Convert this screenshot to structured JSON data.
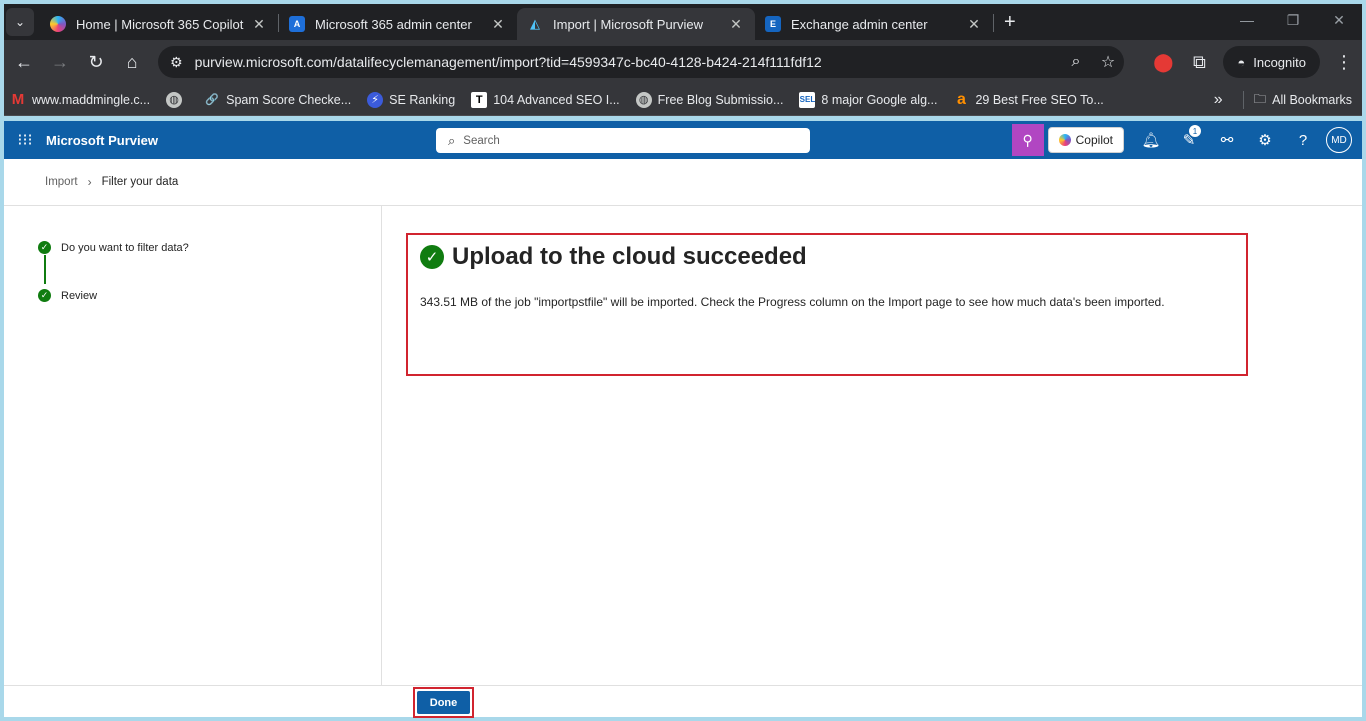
{
  "browser": {
    "tabs": [
      {
        "title": "Home | Microsoft 365 Copilot",
        "icon": "copilot-icon",
        "active": false
      },
      {
        "title": "Microsoft 365 admin center",
        "icon": "admin-center-icon",
        "active": false
      },
      {
        "title": "Import | Microsoft Purview",
        "icon": "purview-icon",
        "active": true
      },
      {
        "title": "Exchange admin center",
        "icon": "exchange-icon",
        "active": false
      }
    ],
    "url": "purview.microsoft.com/datalifecyclemanagement/import?tid=4599347c-bc40-4128-b424-214f111fdf12",
    "incognito_label": "Incognito",
    "bookmarks": [
      {
        "label": "www.maddmingle.c...",
        "icon": "M"
      },
      {
        "label": "",
        "icon": "globe"
      },
      {
        "label": "Spam Score Checke...",
        "icon": "link"
      },
      {
        "label": "SE Ranking",
        "icon": "se"
      },
      {
        "label": "104 Advanced SEO I...",
        "icon": "T"
      },
      {
        "label": "Free Blog Submissio...",
        "icon": "globe"
      },
      {
        "label": "8 major Google alg...",
        "icon": "SEL"
      },
      {
        "label": "29 Best Free SEO To...",
        "icon": "a"
      }
    ],
    "more_bookmarks": "»",
    "all_bookmarks": "All Bookmarks"
  },
  "app": {
    "name": "Microsoft Purview",
    "search_placeholder": "Search",
    "copilot_label": "Copilot",
    "notification_badge": "1",
    "avatar_initials": "MD"
  },
  "breadcrumb": {
    "parent": "Import",
    "current": "Filter your data"
  },
  "steps": [
    {
      "label": "Do you want to filter data?",
      "status": "complete"
    },
    {
      "label": "Review",
      "status": "complete"
    }
  ],
  "result": {
    "title": "Upload to the cloud succeeded",
    "message": "343.51 MB of the job \"importpstfile\" will be imported. Check the Progress column on the Import page to see how much data's been imported."
  },
  "footer": {
    "done_label": "Done"
  },
  "colors": {
    "app_bar": "#0f5fa6",
    "success": "#107c10",
    "highlight_border": "#d1242f"
  }
}
